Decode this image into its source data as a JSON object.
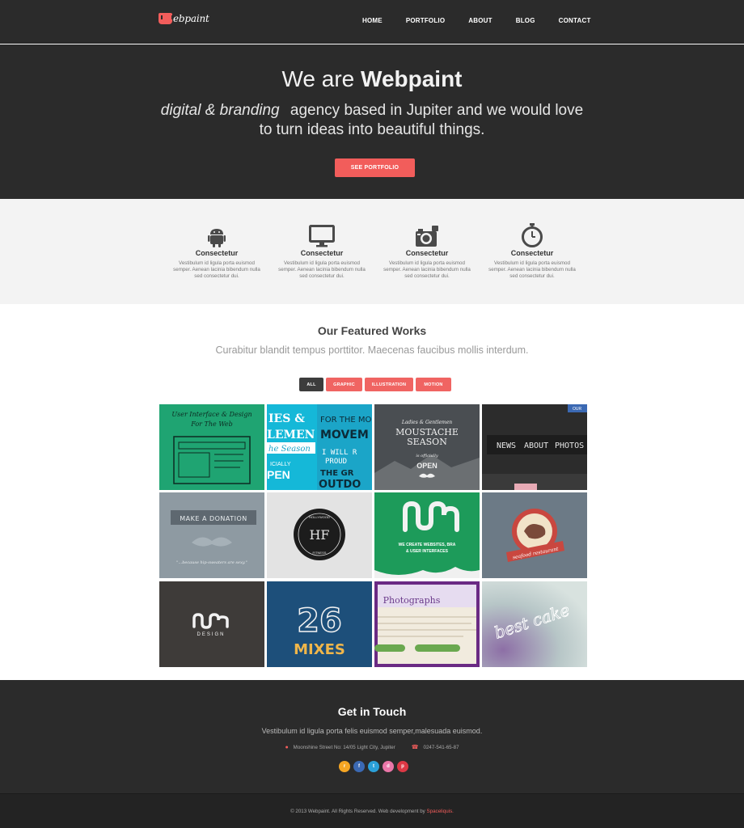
{
  "brand": {
    "logo_text": "ebpaint",
    "accent": "#f25d5b"
  },
  "nav": {
    "items": [
      "HOME",
      "PORTFOLIO",
      "ABOUT",
      "BLOG",
      "CONTACT"
    ]
  },
  "hero": {
    "title_prefix": "We are ",
    "title_bold": "Webpaint",
    "subtitle_italic": "digital & branding",
    "subtitle_rest": "agency based in Jupiter and we would love",
    "subtitle_line2": "to turn ideas into beautiful things.",
    "button": "SEE PORTFOLIO"
  },
  "services": [
    {
      "icon": "android-icon",
      "title": "Consectetur",
      "text": "Vestibulum id ligula porta euismod semper. Aenean lacinia bibendum nulla sed consectetur dui."
    },
    {
      "icon": "monitor-icon",
      "title": "Consectetur",
      "text": "Vestibulum id ligula porta euismod semper. Aenean lacinia bibendum nulla sed consectetur dui."
    },
    {
      "icon": "camera-icon",
      "title": "Consectetur",
      "text": "Vestibulum id ligula porta euismod semper. Aenean lacinia bibendum nulla sed consectetur dui."
    },
    {
      "icon": "stopwatch-icon",
      "title": "Consectetur",
      "text": "Vestibulum id ligula porta euismod semper. Aenean lacinia bibendum nulla sed consectetur dui."
    }
  ],
  "works": {
    "title": "Our Featured Works",
    "subtitle": "Curabitur blandit tempus porttitor. Maecenas faucibus mollis interdum.",
    "filters": [
      "ALL",
      "GRAPHIC",
      "ILLUSTRATION",
      "MOTION"
    ],
    "tiles": [
      {
        "lines": [
          "User Interface & Design",
          "For The Web"
        ],
        "bg": "#1fa472",
        "fg": "#0d2b22"
      },
      {
        "lines": [
          "IES &",
          "LEMEN",
          "he Season",
          "ICIALLY",
          "PEN"
        ],
        "bg": "#1ba5c8",
        "fg": "#ffffff"
      },
      {
        "lines": [
          "Ladies & Gentlemen",
          "MOUSTACHE",
          "SEASON",
          "is officially",
          "OPEN"
        ],
        "bg": "#4a4e52",
        "fg": "#f0f0f0"
      },
      {
        "lines": [
          "NEWS",
          "ABOUT",
          "PHOTOS"
        ],
        "bg": "#2c2c2c",
        "fg": "#e6e6e6"
      },
      {
        "lines": [
          "MAKE A DONATION",
          "\"...because hip-sweaters are sexy.\""
        ],
        "bg": "#8e9aa2",
        "fg": "#e8ecee"
      },
      {
        "lines": [
          "HF",
          "HOLLYWOOD",
          "FITNESS"
        ],
        "bg": "#e3e3e3",
        "fg": "#222222"
      },
      {
        "lines": [
          "WE CREATE WEBSITES, BRA",
          "& USER INTERFACES"
        ],
        "bg": "#1d9b5a",
        "fg": "#ffffff"
      },
      {
        "lines": [
          "seafood restaurant"
        ],
        "bg": "#6c7a86",
        "fg": "#ffffff"
      },
      {
        "lines": [
          "DESIGN"
        ],
        "bg": "#3e3b39",
        "fg": "#f2f2f2"
      },
      {
        "lines": [
          "26",
          "MIXES"
        ],
        "bg": "#1d4f7a",
        "fg": "#f0b64a"
      },
      {
        "lines": [
          "Photographs"
        ],
        "bg": "#f1ebde",
        "fg": "#6a3a8a"
      },
      {
        "lines": [
          "best cake"
        ],
        "bg": "#b7c6c7",
        "fg": "#ffffff"
      }
    ]
  },
  "contact": {
    "title": "Get in Touch",
    "text": "Vestibulum id ligula porta felis euismod semper,malesuada euismod.",
    "address": "Moonshine Street No: 14/05 Light City, Jupiter",
    "phone": "0247-541-65-87",
    "socials": [
      {
        "icon": "rss-icon",
        "color": "#f6a623",
        "glyph": "r"
      },
      {
        "icon": "facebook-icon",
        "color": "#3b69b3",
        "glyph": "f"
      },
      {
        "icon": "twitter-icon",
        "color": "#2ba0d9",
        "glyph": "t"
      },
      {
        "icon": "dribbble-icon",
        "color": "#ea76a8",
        "glyph": "d"
      },
      {
        "icon": "pinterest-icon",
        "color": "#dd3845",
        "glyph": "p"
      }
    ]
  },
  "footer": {
    "text": "© 2013 Webpaint. All Rights Reserved. Web development by ",
    "link": "Spaceliquis."
  }
}
